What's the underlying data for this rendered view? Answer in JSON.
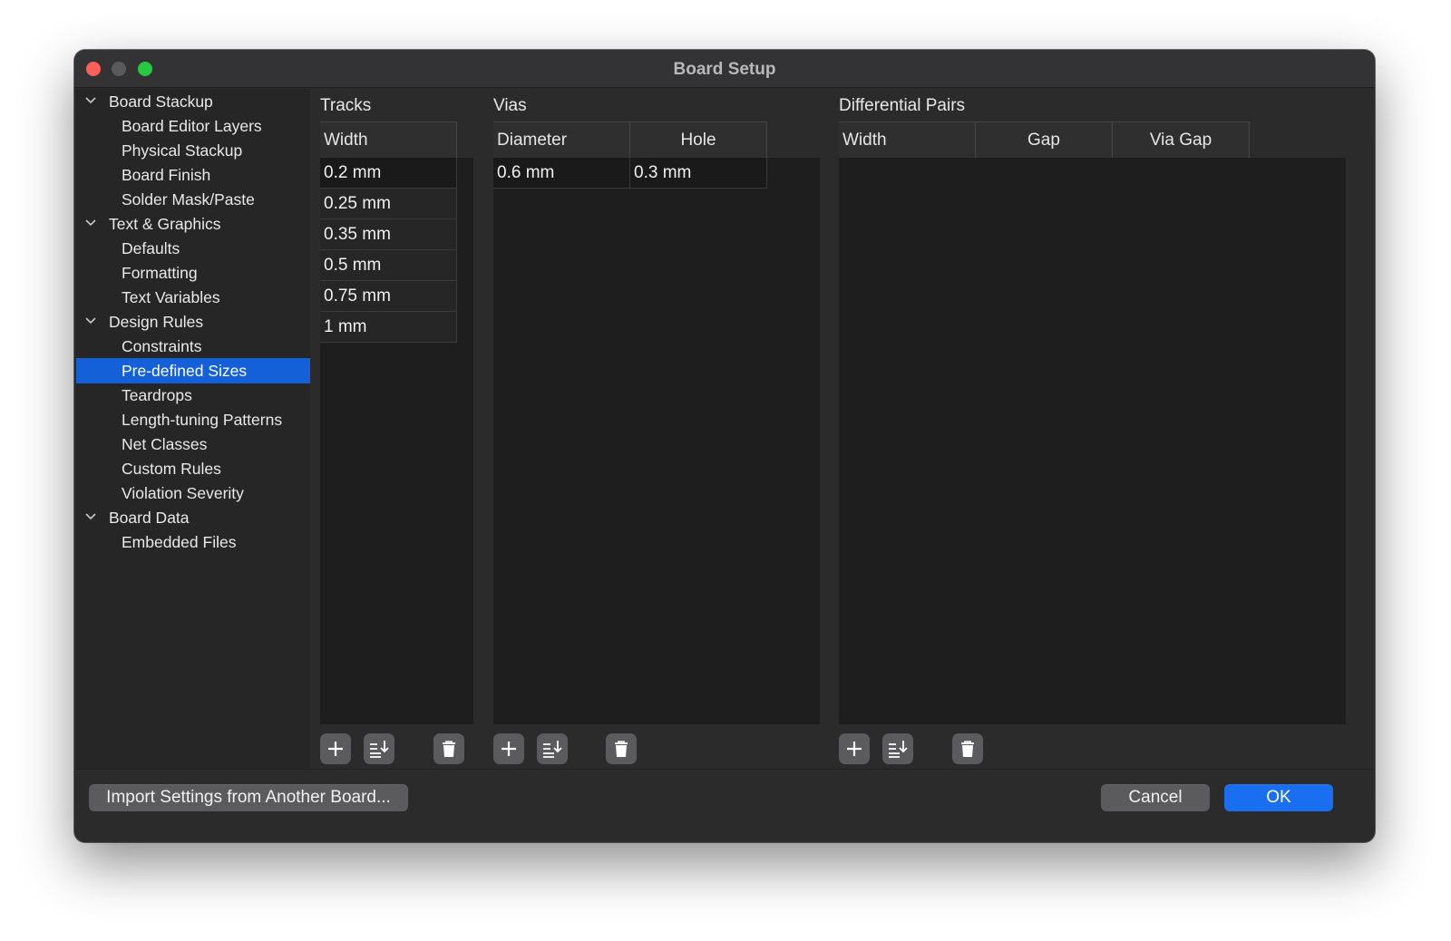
{
  "window": {
    "title": "Board Setup"
  },
  "sidebar": {
    "items": [
      {
        "label": "Board Stackup",
        "level": 0,
        "expanded": true
      },
      {
        "label": "Board Editor Layers",
        "level": 1
      },
      {
        "label": "Physical Stackup",
        "level": 1
      },
      {
        "label": "Board Finish",
        "level": 1
      },
      {
        "label": "Solder Mask/Paste",
        "level": 1
      },
      {
        "label": "Text & Graphics",
        "level": 0,
        "expanded": true
      },
      {
        "label": "Defaults",
        "level": 1
      },
      {
        "label": "Formatting",
        "level": 1
      },
      {
        "label": "Text Variables",
        "level": 1
      },
      {
        "label": "Design Rules",
        "level": 0,
        "expanded": true
      },
      {
        "label": "Constraints",
        "level": 1
      },
      {
        "label": "Pre-defined Sizes",
        "level": 1,
        "selected": true
      },
      {
        "label": "Teardrops",
        "level": 1
      },
      {
        "label": "Length-tuning Patterns",
        "level": 1
      },
      {
        "label": "Net Classes",
        "level": 1
      },
      {
        "label": "Custom Rules",
        "level": 1
      },
      {
        "label": "Violation Severity",
        "level": 1
      },
      {
        "label": "Board Data",
        "level": 0,
        "expanded": true
      },
      {
        "label": "Embedded Files",
        "level": 1
      }
    ]
  },
  "tracks": {
    "title": "Tracks",
    "columns": [
      "Width"
    ],
    "rows": [
      "0.2 mm",
      "0.25 mm",
      "0.35 mm",
      "0.5 mm",
      "0.75 mm",
      "1 mm"
    ]
  },
  "vias": {
    "title": "Vias",
    "columns": [
      "Diameter",
      "Hole"
    ],
    "rows": [
      [
        "0.6 mm",
        "0.3 mm"
      ]
    ]
  },
  "diff_pairs": {
    "title": "Differential Pairs",
    "columns": [
      "Width",
      "Gap",
      "Via Gap"
    ],
    "rows": []
  },
  "toolbar_icons": [
    "add-icon",
    "sort-icon",
    "delete-icon"
  ],
  "footer": {
    "import_label": "Import Settings from Another Board...",
    "cancel_label": "Cancel",
    "ok_label": "OK"
  },
  "colors": {
    "selection": "#1460d8",
    "ok_button": "#1a6ef0",
    "close": "#fe5f57",
    "maximize": "#28c840"
  }
}
